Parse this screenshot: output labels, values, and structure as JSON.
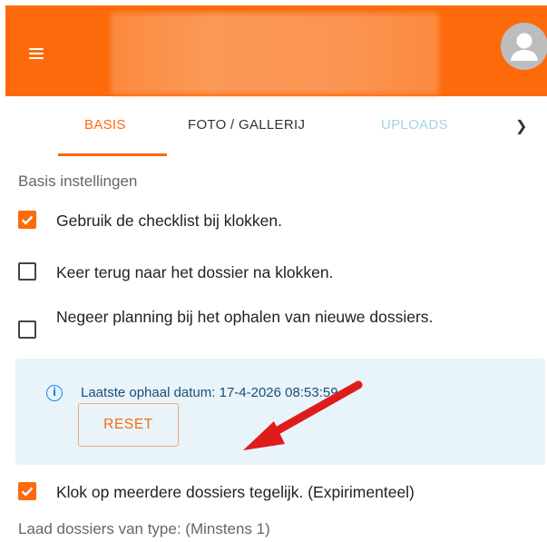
{
  "appbar": {
    "menu_icon": "hamburger-menu-icon",
    "avatar_icon": "account-circle-icon",
    "color": "#fd6a0b"
  },
  "tabs": {
    "items": [
      {
        "label": "BASIS",
        "active": true
      },
      {
        "label": "FOTO / GALLERIJ",
        "active": false
      },
      {
        "label": "UPLOADS",
        "active": false,
        "disabled": true
      }
    ],
    "next_icon": "chevron-right-icon"
  },
  "section": {
    "heading": "Basis instellingen"
  },
  "settings": [
    {
      "label": "Gebruik de checklist bij klokken.",
      "checked": true
    },
    {
      "label": "Keer terug naar het dossier na klokken.",
      "checked": false
    },
    {
      "label": "Negeer planning bij het ophalen van nieuwe dossiers.",
      "checked": false
    }
  ],
  "info": {
    "icon": "info-icon",
    "text": "Laatste ophaal datum: 17-4-2026 08:53:59",
    "reset_label": "RESET",
    "bg": "#e8f4fa"
  },
  "multi": {
    "label": "Klok op meerdere dossiers tegelijk. (Expirimenteel)",
    "checked": true
  },
  "footer": {
    "heading": "Laad dossiers van type: (Minstens 1)"
  },
  "annotation": {
    "arrow_color": "#e01b1b"
  }
}
